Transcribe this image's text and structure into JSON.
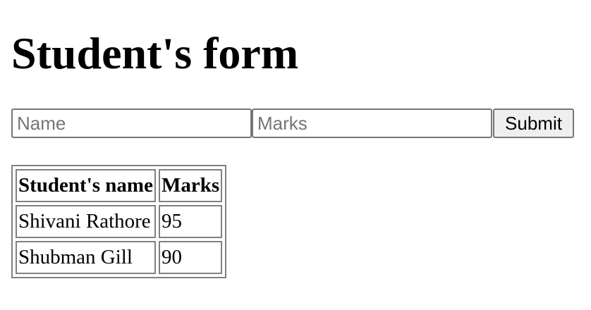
{
  "page": {
    "title": "Student's form"
  },
  "form": {
    "name_placeholder": "Name",
    "name_value": "",
    "marks_placeholder": "Marks",
    "marks_value": "",
    "submit_label": "Submit"
  },
  "table": {
    "headers": [
      "Student's name",
      "Marks"
    ],
    "rows": [
      [
        "Shivani Rathore",
        "95"
      ],
      [
        "Shubman Gill",
        "90"
      ]
    ]
  }
}
